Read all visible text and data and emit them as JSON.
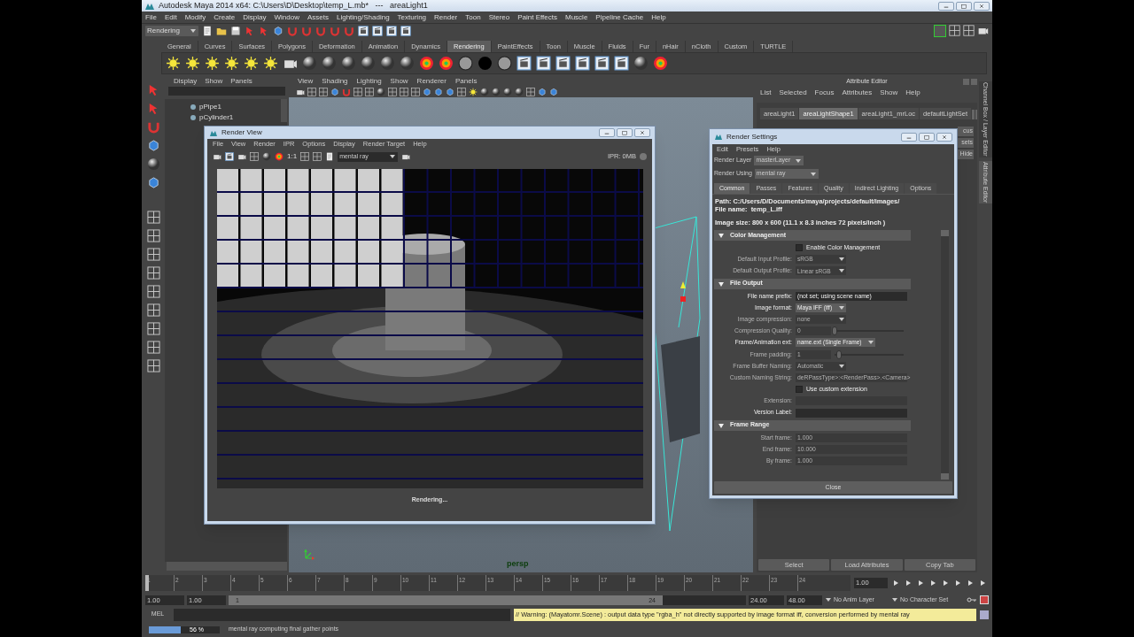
{
  "window": {
    "title": "Autodesk Maya 2014 x64: C:\\Users\\D\\Desktop\\temp_L.mb*   ---   areaLight1"
  },
  "menu_bar": [
    "File",
    "Edit",
    "Modify",
    "Create",
    "Display",
    "Window",
    "Assets",
    "Lighting/Shading",
    "Texturing",
    "Render",
    "Toon",
    "Stereo",
    "Paint Effects",
    "Muscle",
    "Pipeline Cache",
    "Help"
  ],
  "menu_set": {
    "value": "Rendering"
  },
  "shelf_tabs": [
    {
      "label": "General",
      "selected": false
    },
    {
      "label": "Curves",
      "selected": false
    },
    {
      "label": "Surfaces",
      "selected": false
    },
    {
      "label": "Polygons",
      "selected": false
    },
    {
      "label": "Deformation",
      "selected": false
    },
    {
      "label": "Animation",
      "selected": false
    },
    {
      "label": "Dynamics",
      "selected": false
    },
    {
      "label": "Rendering",
      "selected": true
    },
    {
      "label": "PaintEffects",
      "selected": false
    },
    {
      "label": "Toon",
      "selected": false
    },
    {
      "label": "Muscle",
      "selected": false
    },
    {
      "label": "Fluids",
      "selected": false
    },
    {
      "label": "Fur",
      "selected": false
    },
    {
      "label": "nHair",
      "selected": false
    },
    {
      "label": "nCloth",
      "selected": false
    },
    {
      "label": "Custom",
      "selected": false
    },
    {
      "label": "TURTLE",
      "selected": false
    }
  ],
  "outliner": {
    "menus": [
      "Display",
      "Show",
      "Panels"
    ],
    "items": [
      {
        "label": "pPipe1"
      },
      {
        "label": "pCylinder1"
      }
    ]
  },
  "viewport": {
    "menus": [
      "View",
      "Shading",
      "Lighting",
      "Show",
      "Renderer",
      "Panels"
    ],
    "camera_label": "persp"
  },
  "render_view": {
    "title": "Render View",
    "menus": [
      "File",
      "View",
      "Render",
      "IPR",
      "Options",
      "Display",
      "Render Target",
      "Help"
    ],
    "zoom_label": "1:1",
    "renderer": "mental ray",
    "ipr_status": "IPR: 0MB",
    "status": "Rendering..."
  },
  "render_settings": {
    "title": "Render Settings",
    "menus": [
      "Edit",
      "Presets",
      "Help"
    ],
    "render_layer": {
      "label": "Render Layer",
      "value": "masterLayer"
    },
    "render_using": {
      "label": "Render Using",
      "value": "mental ray"
    },
    "tabs": [
      {
        "label": "Common",
        "selected": true
      },
      {
        "label": "Passes",
        "selected": false
      },
      {
        "label": "Features",
        "selected": false
      },
      {
        "label": "Quality",
        "selected": false
      },
      {
        "label": "Indirect Lighting",
        "selected": false
      },
      {
        "label": "Options",
        "selected": false
      }
    ],
    "info": [
      "Path: C:/Users/D/Documents/maya/projects/default/images/",
      "File name:  temp_L.iff",
      "Image size: 800 x 600 (11.1 x 8.3 inches 72 pixels/inch )"
    ],
    "sections": [
      {
        "title": "Color Management",
        "expanded": true,
        "fields": [
          {
            "kind": "checkbox",
            "label": "Enable Color Management",
            "checked": false,
            "disabled": false
          },
          {
            "kind": "dropdown",
            "label": "Default Input Profile:",
            "value": "sRGB",
            "disabled": true
          },
          {
            "kind": "dropdown",
            "label": "Default Output Profile:",
            "value": "Linear sRGB",
            "disabled": true
          }
        ]
      },
      {
        "title": "File Output",
        "expanded": true,
        "fields": [
          {
            "kind": "text",
            "label": "File name prefix:",
            "value": "(not set; using scene name)",
            "disabled": false
          },
          {
            "kind": "dropdown",
            "label": "Image format:",
            "value": "Maya IFF (iff)",
            "disabled": false
          },
          {
            "kind": "dropdown",
            "label": "Image compression:",
            "value": "none",
            "disabled": true
          },
          {
            "kind": "slider",
            "label": "Compression Quality:",
            "value": "0",
            "level": 0,
            "disabled": true
          },
          {
            "kind": "dropdown",
            "label": "Frame/Animation ext:",
            "value": "name.ext (Single Frame)",
            "disabled": false
          },
          {
            "kind": "slider",
            "label": "Frame padding:",
            "value": "1",
            "level": 0.06,
            "disabled": true
          },
          {
            "kind": "dropdown",
            "label": "Frame Buffer Naming:",
            "value": "Automatic",
            "disabled": true
          },
          {
            "kind": "text",
            "label": "Custom Naming String:",
            "value": "deRPassType>:<RenderPass>.<Camera>",
            "disabled": true
          },
          {
            "kind": "checkbox",
            "label": "Use custom extension",
            "checked": false,
            "disabled": false
          },
          {
            "kind": "text",
            "label": "Extension:",
            "disabled": true
          },
          {
            "kind": "text",
            "label": "Version Label:",
            "disabled": false
          }
        ]
      },
      {
        "title": "Frame Range",
        "expanded": true,
        "fields": [
          {
            "kind": "text",
            "label": "Start frame:",
            "value": "1.000",
            "disabled": true
          },
          {
            "kind": "text",
            "label": "End frame:",
            "value": "10.000",
            "disabled": true
          },
          {
            "kind": "text",
            "label": "By frame:",
            "value": "1.000",
            "disabled": true
          }
        ]
      }
    ],
    "close_button": "Close"
  },
  "attribute_editor": {
    "title": "Attribute Editor",
    "menus": [
      "List",
      "Selected",
      "Focus",
      "Attributes",
      "Show",
      "Help"
    ],
    "tabs": [
      {
        "label": "areaLight1",
        "selected": false
      },
      {
        "label": "areaLightShape1",
        "selected": true
      },
      {
        "label": "areaLight1_mrLoc",
        "selected": false
      },
      {
        "label": "defaultLightSet",
        "selected": false
      }
    ],
    "side_buttons": [
      "cus",
      "sets",
      "Hide"
    ],
    "bottom_buttons": [
      "Select",
      "Load Attributes",
      "Copy Tab"
    ]
  },
  "side_tabs": [
    "Channel Box / Layer Editor",
    "Attribute Editor"
  ],
  "time_slider": {
    "level": 0,
    "ticks": [
      "1",
      "2",
      "3",
      "4",
      "5",
      "6",
      "7",
      "8",
      "9",
      "10",
      "11",
      "12",
      "13",
      "14",
      "15",
      "16",
      "17",
      "18",
      "19",
      "20",
      "21",
      "22",
      "23",
      "24"
    ],
    "current_frame": "1.00"
  },
  "range_slider": {
    "start": "1.00",
    "playback_start": "1.00",
    "range_start_label": "1",
    "range_end_label": "24",
    "playback_end": "24.00",
    "end": "48.00",
    "anim_layer": "No Anim Layer",
    "character_set": "No Character Set"
  },
  "command_line": {
    "label": "MEL",
    "result": "// Warning: (Mayatomr.Scene) : output data type \"rgba_h\" not directly supported by image format iff, conversion performed by mental ray"
  },
  "help_line": {
    "progress": {
      "level": 0.45,
      "reading": "56 %"
    },
    "message": "mental ray computing final gather points"
  }
}
